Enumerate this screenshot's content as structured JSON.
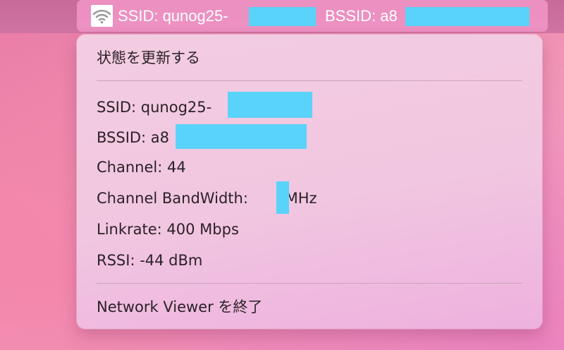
{
  "menubar": {
    "icon": "wifi-icon",
    "ssid_label": "SSID: qunog25-",
    "bssid_label": "BSSID: a8"
  },
  "menu": {
    "refresh": "状態を更新する",
    "ssid": "SSID: qunog25-",
    "bssid": "BSSID: a8",
    "channel": "Channel: 44",
    "bandwidth_prefix": "Channel BandWidth:",
    "bandwidth_unit": "MHz",
    "linkrate": "Linkrate: 400 Mbps",
    "rssi": "RSSI: -44 dBm",
    "quit": "Network Viewer を終了"
  },
  "colors": {
    "redaction": "#5ad3fa",
    "menu_text": "#2b2127"
  }
}
